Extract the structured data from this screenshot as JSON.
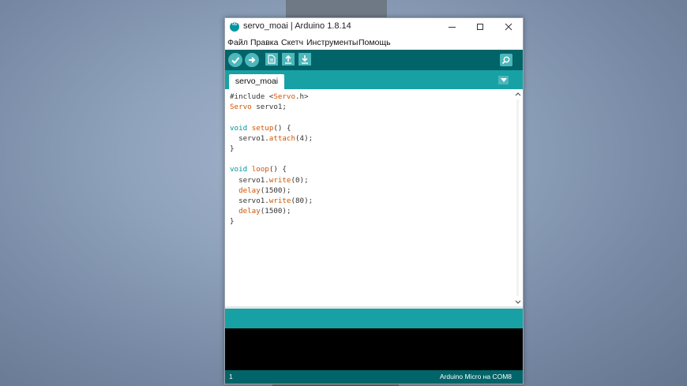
{
  "window": {
    "title": "servo_moai | Arduino 1.8.14"
  },
  "menu": [
    "Файл",
    "Правка",
    "Скетч",
    "Инструменты",
    "Помощь"
  ],
  "toolbar": {
    "verify_icon": "check-icon",
    "upload_icon": "arrow-right-icon",
    "new_icon": "new-file-icon",
    "open_icon": "arrow-up-icon",
    "save_icon": "arrow-down-icon",
    "serial_icon": "magnifier-icon"
  },
  "tabs": [
    {
      "label": "servo_moai"
    }
  ],
  "code": {
    "lines": [
      "#include <Servo.h>",
      "Servo servo1;",
      "",
      "void setup() {",
      "  servo1.attach(4);",
      "}",
      "",
      "void loop() {",
      "  servo1.write(0);",
      "  delay(1500);",
      "  servo1.write(80);",
      "  delay(1500);",
      "}"
    ]
  },
  "status": {
    "line_number": "1",
    "board": "Arduino Micro на COM8"
  },
  "colors": {
    "toolbar_dark": "#006468",
    "toolbar_light": "#17a1a5",
    "button": "#4db7bb"
  }
}
